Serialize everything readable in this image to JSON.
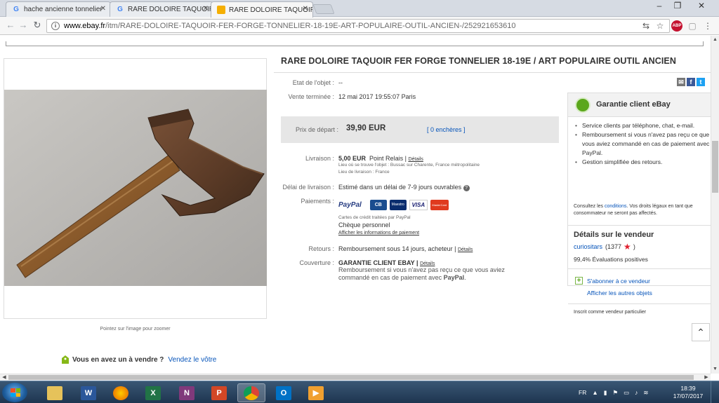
{
  "browser": {
    "tabs": [
      {
        "label": "hache ancienne tonnelier",
        "favicon": "google-g"
      },
      {
        "label": "RARE DOLOIRE TAQUOIR",
        "favicon": "google-g"
      },
      {
        "label": "RARE DOLOIRE TAQUOIR",
        "favicon": "ebay-bag",
        "active": true
      }
    ],
    "url_host": "www.ebay.fr",
    "url_path": "/itm/RARE-DOLOIRE-TAQUOIR-FER-FORGE-TONNELIER-18-19E-ART-POPULAIRE-OUTIL-ANCIEN-/252921653610",
    "icons": [
      "back-arrow-icon",
      "forward-arrow-icon",
      "reload-icon",
      "info-icon",
      "translate-icon",
      "star-icon",
      "abp-icon",
      "extension-icon",
      "menu-icon"
    ]
  },
  "listing": {
    "title": "RARE DOLOIRE TAQUOIR FER FORGE TONNELIER 18-19E / ART POPULAIRE OUTIL ANCIEN",
    "condition_label": "Etat de l'objet :",
    "condition_value": "--",
    "ended_label": "Vente terminée :",
    "ended_value": "12 mai 2017   19:55:07 Paris",
    "price_label": "Prix de départ :",
    "price_value": "39,90 EUR",
    "bids": "[ 0 enchères ]",
    "delivery_label": "Livraison :",
    "delivery_price": "5,00 EUR",
    "delivery_method": "Point Relais |",
    "details_link": "Détails",
    "item_location": "Lieu où se trouve l'objet :  Bussac sur Charente, France métropolitaine",
    "ship_to": "Lieu de livraison :   France",
    "delay_label": "Délai de livraison :",
    "delay_value": "Estimé dans un délai de 7-9 jours ouvrables",
    "payments_label": "Paiements :",
    "cards_note": "Cartes de crédit traitées par PayPal",
    "cheque": "Chèque personnel",
    "payment_info_link": "Afficher les informations de paiement",
    "returns_label": "Retours :",
    "returns_value": "Remboursement sous 14 jours, acheteur |",
    "coverage_label": "Couverture :",
    "coverage_title": "GARANTIE CLIENT EBAY |",
    "coverage_text": "Remboursement si vous n'avez pas reçu ce que vous aviez commandé en cas de paiement avec",
    "coverage_paypal": "PayPal",
    "payment_logos": {
      "paypal": "PayPal",
      "cb": "CB",
      "maestro": "Maestro",
      "visa": "VISA",
      "mastercard": "MasterCard"
    },
    "zoom_hint": "Pointez sur l'image pour zoomer",
    "sell_question": "Vous en avez un à vendre ?",
    "sell_link": "Vendez le vôtre"
  },
  "guarantee": {
    "title": "Garantie client eBay",
    "items": [
      "Service clients par téléphone, chat, e-mail.",
      "Remboursement si vous n'avez pas reçu ce que vous aviez commandé en cas de paiement avec PayPal.",
      "Gestion simplifiée des retours."
    ],
    "note_prefix": "Consultez les",
    "note_link": "conditions",
    "note_suffix": ". Vos droits légaux en tant que consommateur ne seront pas affectés.",
    "seller_title": "Détails sur le vendeur",
    "seller_name": "curiositars",
    "seller_score_open": "(1377",
    "seller_score_close": ")",
    "feedback": "99,4% Évaluations positives",
    "follow": "S'abonner à ce vendeur",
    "other_items": "Afficher les autres objets",
    "registered": "Inscrit comme vendeur particulier"
  },
  "taskbar": {
    "apps": [
      "explorer",
      "word",
      "firefox",
      "excel",
      "onenote",
      "powerpoint",
      "chrome",
      "outlook",
      "media-player"
    ],
    "language": "FR",
    "time": "18:39",
    "date": "17/07/2017"
  },
  "colors": {
    "link": "#0654ba",
    "ebay_green": "#5ba71b",
    "price_bg": "#e6e6e6"
  }
}
